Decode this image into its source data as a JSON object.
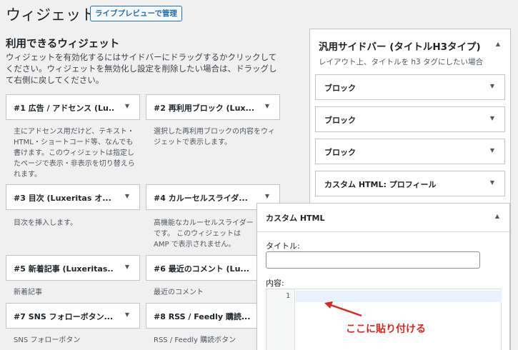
{
  "header": {
    "title": "ウィジェット",
    "live_preview_button": "ライブプレビューで管理"
  },
  "available": {
    "title": "利用できるウィジェット",
    "description": "ウィジェットを有効化するにはサイドバーにドラッグするかクリックしてください。ウィジェットを無効化し設定を削除したい場合は、ドラッグして右側に戻してください。",
    "widgets": [
      {
        "title": "#1 広告 / アドセンス (Lu...",
        "desc": "主にアドセンス用だけど、テキスト・HTML・ショートコード等、なんでも書けます。このウィジェットは指定したページで表示・非表示を切り替えられます。"
      },
      {
        "title": "#2 再利用ブロック (Lux...",
        "desc": "選択した再利用ブロックの内容をウィジェットで表示します。"
      },
      {
        "title": "#3 目次 (Luxeritas オ...",
        "desc": "目次を挿入します。"
      },
      {
        "title": "#4 カルーセルスライダ...",
        "desc": "高機能なカルーセルスライダーです。 このウィジェットは AMP で表示されません。"
      },
      {
        "title": "#5 新着記事 (Luxeritas...",
        "desc": "新着記事"
      },
      {
        "title": "#6 最近のコメント (Lu...",
        "desc": "最近のコメント"
      },
      {
        "title": "#7 SNS フォローボタン...",
        "desc": "SNS フォローボタン"
      },
      {
        "title": "#8 RSS / Feedly 購読...",
        "desc": "RSS / Feedly 購読ボタン"
      }
    ]
  },
  "sidebar": {
    "title": "汎用サイドバー (タイトルH3タイプ)",
    "description": "レイアウト上、タイトルを h3 タグにしたい場合",
    "items": [
      {
        "title": "ブロック"
      },
      {
        "title": "ブロック"
      },
      {
        "title": "ブロック"
      },
      {
        "title": "カスタム HTML: プロフィール"
      }
    ]
  },
  "custom_html": {
    "title": "カスタム HTML",
    "title_label": "タイトル:",
    "title_value": "",
    "content_label": "内容:",
    "line_number": "1"
  },
  "annotation": {
    "text": "ここに貼り付ける",
    "color": "#e0251f"
  },
  "icons": {
    "collapsed": "▼",
    "expanded": "▲"
  }
}
